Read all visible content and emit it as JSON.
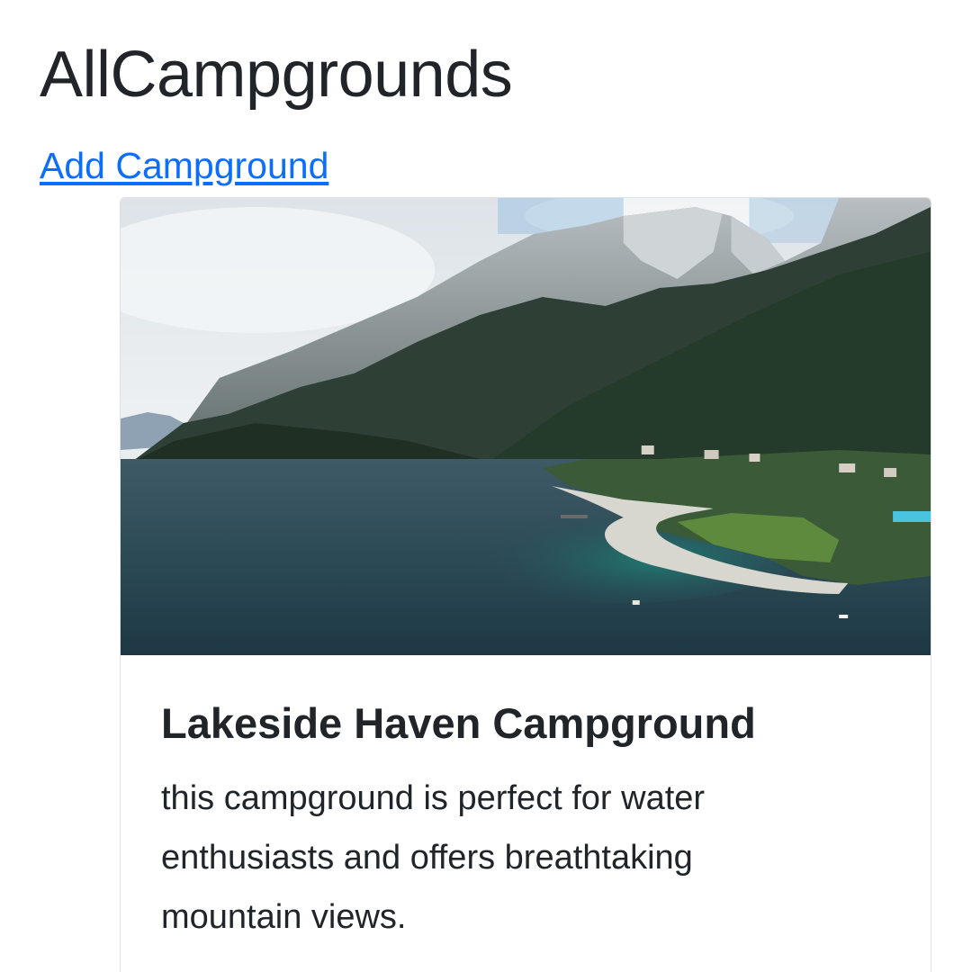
{
  "page": {
    "title": "AllCampgrounds",
    "add_link_label": "Add Campground"
  },
  "campgrounds": [
    {
      "title": "Lakeside Haven Campground",
      "description": "this campground is perfect for water enthusiasts and offers breathtaking mountain views.",
      "image_alt": "Aerial view of a lake with a beach, green trees and steep rocky mountains"
    }
  ],
  "colors": {
    "link": "#0d6efd",
    "text": "#212529",
    "card_border": "#dfe2e5"
  }
}
